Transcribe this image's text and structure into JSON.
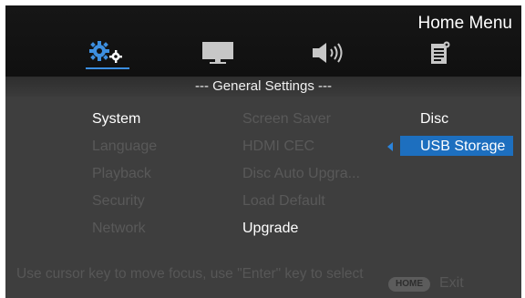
{
  "header": {
    "title": "Home Menu"
  },
  "tabs": [
    {
      "icon": "gear-icon",
      "active": true
    },
    {
      "icon": "monitor-icon",
      "active": false
    },
    {
      "icon": "speaker-icon",
      "active": false
    },
    {
      "icon": "document-icon",
      "active": false
    }
  ],
  "section": {
    "title": "--- General Settings ---"
  },
  "menu": {
    "categories": [
      "System",
      "Language",
      "Playback",
      "Security",
      "Network"
    ],
    "system_items": [
      "Screen Saver",
      "HDMI CEC",
      "Disc Auto Upgra...",
      "Load Default",
      "Upgrade"
    ],
    "options": [
      "Disc",
      "USB Storage"
    ]
  },
  "footer": {
    "help": "Use cursor key to move focus, use \"Enter\" key to select",
    "home_button": "HOME",
    "exit_label": "Exit"
  },
  "colors": {
    "accent": "#1d6fbf",
    "background": "#3e3e3e"
  }
}
